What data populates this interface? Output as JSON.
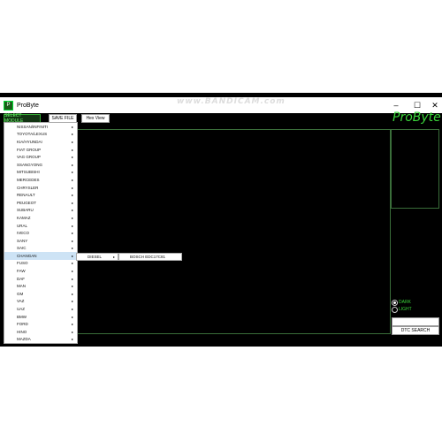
{
  "window": {
    "title": "ProByte",
    "controls": {
      "minimize": "–",
      "maximize": "☐",
      "close": "✕"
    }
  },
  "watermark": "www.BANDICAM.com",
  "toolbar": {
    "select_module": "SELECT MODULE",
    "save_file": "SAVE FILE",
    "hex_view": "Hex View"
  },
  "brand": "ProByte",
  "menu": {
    "items": [
      "NISSAN/INFINITI",
      "TOYOTA/LEXUS",
      "KIA/HYUNDAI",
      "FIAT GROUP",
      "VAG GROUP",
      "SSANGYONG",
      "MITSUBISHI",
      "MERCEDES",
      "CHRYSLER",
      "RENAULT",
      "PEUGEOT",
      "SUBARU",
      "KAMAZ",
      "URAL",
      "IVECO",
      "SANY",
      "SAIC",
      "CHANGAN",
      "FUSO",
      "FAW",
      "DAF",
      "MAN",
      "GM",
      "VAZ",
      "UAZ",
      "BMW",
      "FORD",
      "HINO",
      "MAZDA"
    ],
    "highlighted": "CHANGAN",
    "submenu_1": "DIESEL",
    "submenu_2": "BOSCH EDC17C81"
  },
  "options": {
    "dark": "DARK",
    "light": "LIGHT"
  },
  "dtc_button": "DTC SEARCH"
}
